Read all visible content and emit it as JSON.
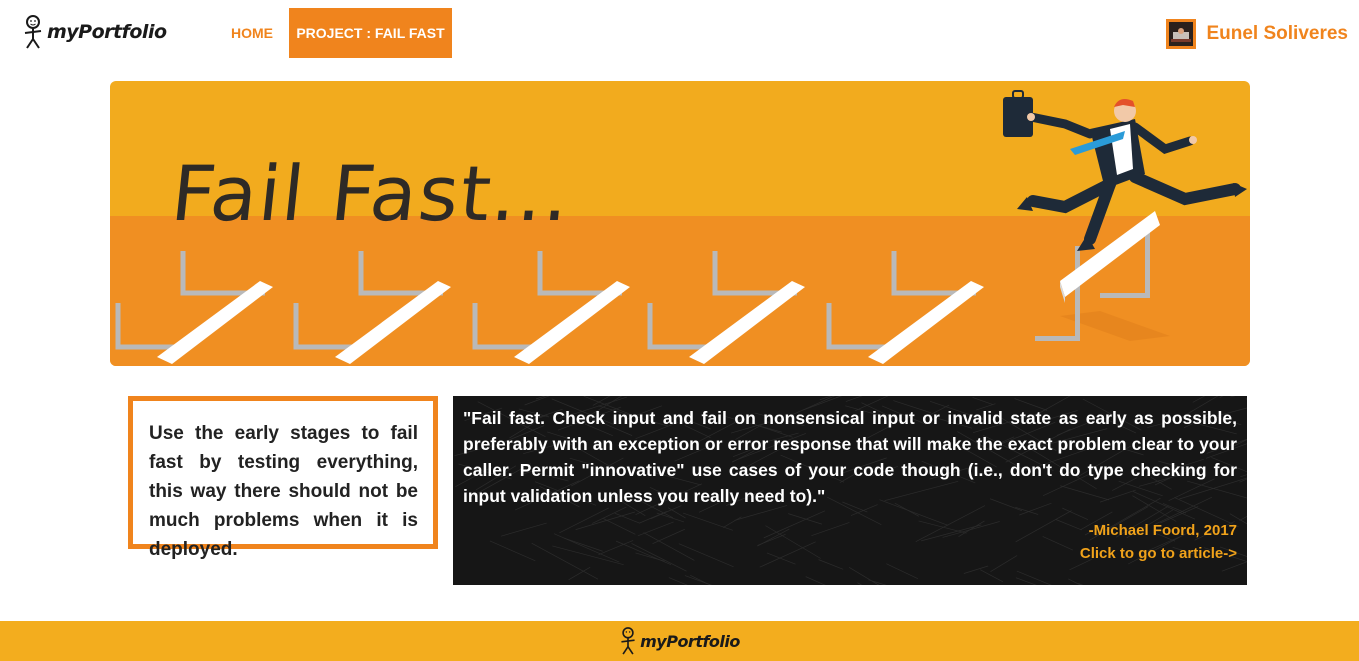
{
  "nav": {
    "brand": "myPortfolio",
    "home_label": "HOME",
    "project_label": "PROJECT : FAIL FAST",
    "user_name": "Eunel Soliveres"
  },
  "hero": {
    "title": "Fail Fast..."
  },
  "tip": {
    "text": "Use the early stages to fail fast by testing everything, this way there should not be much problems when it is deployed."
  },
  "quote": {
    "text": "\"Fail fast. Check input and fail on nonsensical input or invalid state as early as possible, preferably with an exception or error response that will make the exact problem clear to your caller. Permit \"innovative\" use cases of your code though (i.e., don't do type checking for input validation unless you really need to).\"",
    "author": "-Michael Foord, 2017",
    "link_label": "Click to go to article->"
  },
  "footer": {
    "brand": "myPortfolio"
  },
  "colors": {
    "accent": "#f0841d",
    "hero_top": "#f2ab1e",
    "hero_bottom": "#f08f22",
    "footer": "#f3ad1e",
    "quote_text_accent": "#f0a21a"
  },
  "icons": [
    "stickman-logo-icon",
    "avatar-photo-icon",
    "hurdles-illustration",
    "businessman-jumping-illustration"
  ]
}
